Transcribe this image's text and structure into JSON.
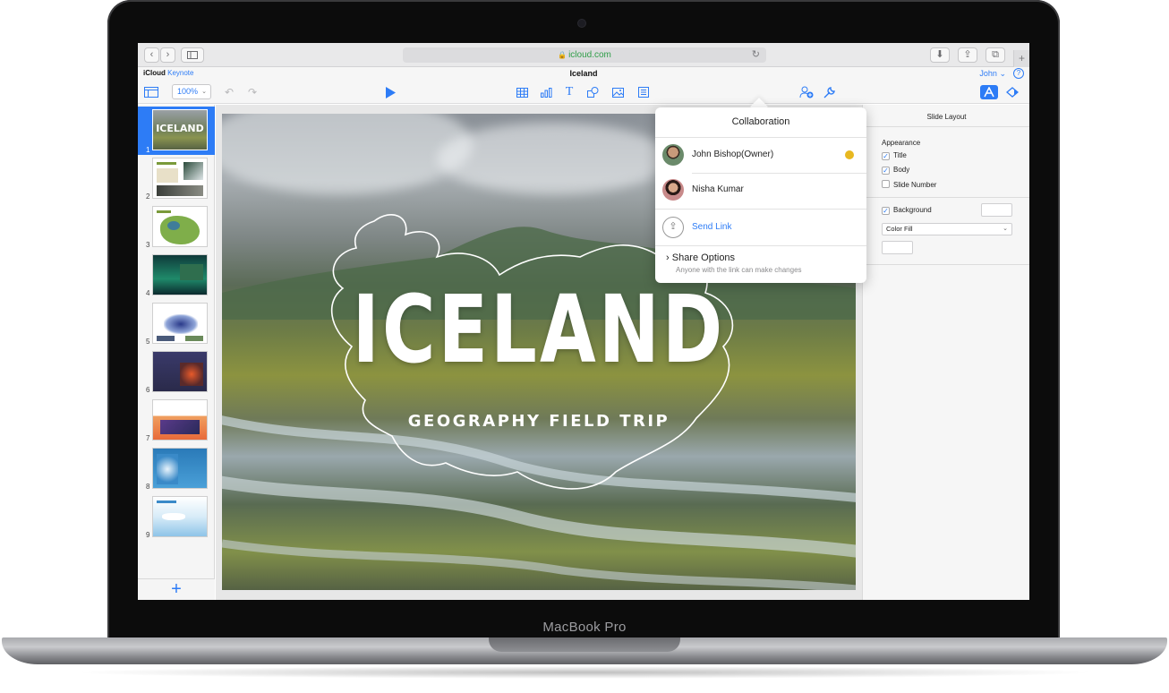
{
  "device": {
    "label": "MacBook Pro"
  },
  "browser": {
    "url": "icloud.com",
    "icons": [
      "back-icon",
      "forward-icon",
      "sidebar-icon",
      "reload-icon",
      "download-icon",
      "share-icon",
      "tabs-icon",
      "plus-icon"
    ]
  },
  "app": {
    "brand": "iCloud",
    "product": "Keynote",
    "doc_title": "Iceland",
    "user": "John",
    "help": "?"
  },
  "toolbar": {
    "zoom": "100%",
    "icons": [
      "navigator-view-icon",
      "undo-icon",
      "redo-icon",
      "play-icon",
      "table-icon",
      "chart-icon",
      "text-icon",
      "shape-icon",
      "media-icon",
      "comment-icon",
      "collaborate-icon",
      "wrench-icon",
      "format-icon",
      "animate-icon"
    ]
  },
  "navigator": {
    "slides": [
      {
        "number": "1",
        "label": "ICELAND",
        "selected": true
      },
      {
        "number": "2"
      },
      {
        "number": "3"
      },
      {
        "number": "4"
      },
      {
        "number": "5"
      },
      {
        "number": "6"
      },
      {
        "number": "7"
      },
      {
        "number": "8"
      },
      {
        "number": "9"
      }
    ],
    "add_label": "+"
  },
  "slide": {
    "title": "ICELAND",
    "subtitle": "GEOGRAPHY FIELD TRIP"
  },
  "collaboration": {
    "title": "Collaboration",
    "people": [
      {
        "name": "John Bishop(Owner)",
        "presence_color": "#e8b820"
      },
      {
        "name": "Nisha Kumar"
      }
    ],
    "send_link": "Send Link",
    "share_options": "Share Options",
    "share_desc": "Anyone with the link can make changes"
  },
  "inspector": {
    "title": "Slide Layout",
    "appearance_heading": "Appearance",
    "options": [
      {
        "label": "Title",
        "checked": true
      },
      {
        "label": "Body",
        "checked": true
      },
      {
        "label": "Slide Number",
        "checked": false
      }
    ],
    "background": {
      "label": "Background",
      "checked": true
    },
    "fill_type": "Color Fill"
  },
  "colors": {
    "accent": "#2d7cf6",
    "url_green": "#2f9e48",
    "presence": "#e8b820"
  }
}
